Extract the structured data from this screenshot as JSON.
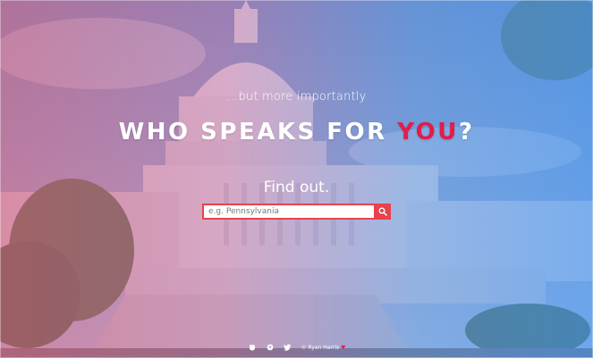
{
  "hero": {
    "subtitle": "...but more importantly",
    "headline_prefix": "WHO SPEAKS FOR ",
    "headline_accent": "YOU",
    "headline_suffix": "?",
    "cta": "Find out."
  },
  "search": {
    "placeholder": "e.g. Pennsylvania",
    "value": "",
    "button_icon": "search-icon"
  },
  "footer": {
    "icons": [
      "github-icon",
      "globe-icon",
      "twitter-icon"
    ],
    "credit": "© Ryan Harris",
    "heart": "♥"
  },
  "colors": {
    "accent": "#e21d4a",
    "search_border": "#e8424c",
    "overlay_left": "#d66080",
    "overlay_right": "#4696f0"
  }
}
